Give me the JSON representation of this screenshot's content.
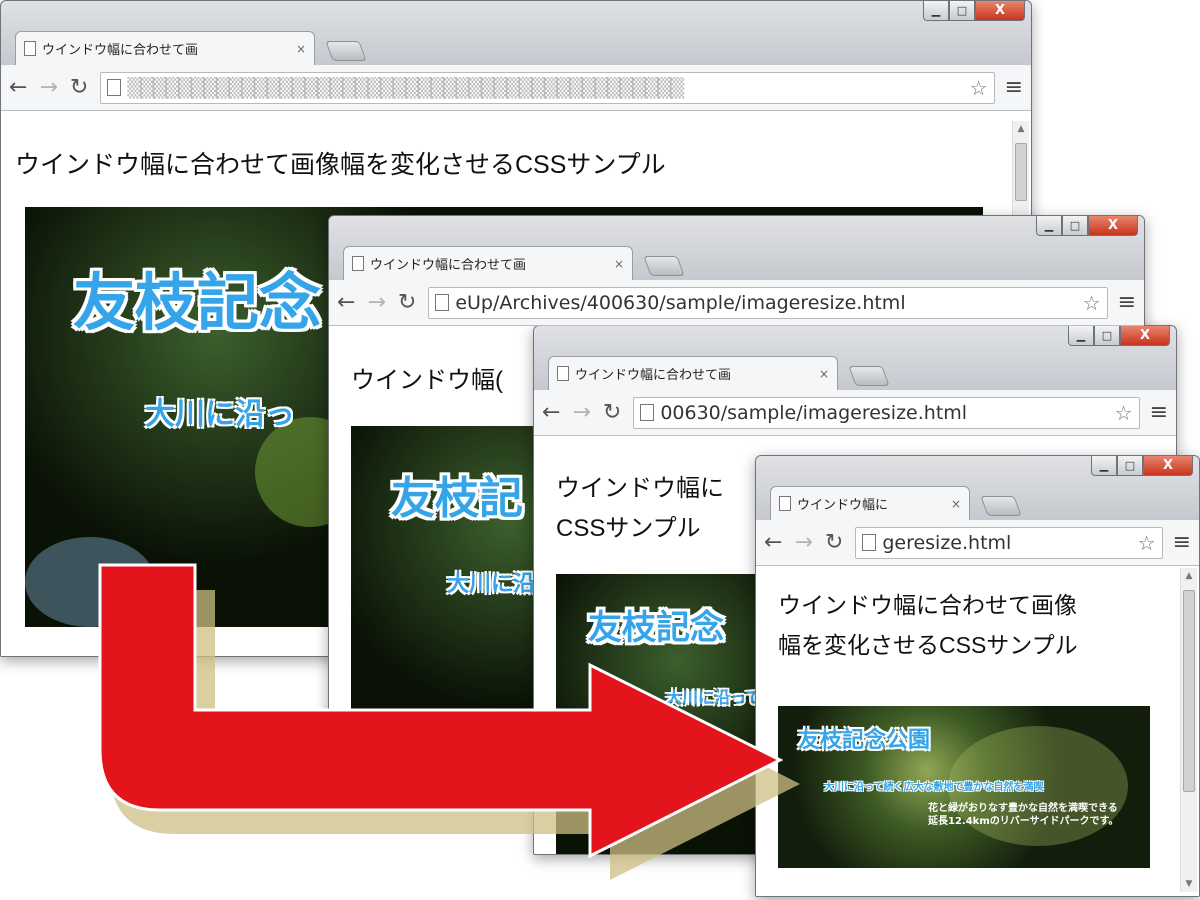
{
  "windows": [
    {
      "tab_title": "ウインドウ幅に合わせて画",
      "url": "▒▒▒▒▒▒▒▒▒▒▒▒▒▒▒▒▒▒▒▒▒▒▒▒▒▒▒▒▒▒▒▒▒▒▒▒▒▒▒▒▒▒▒▒",
      "page_title": "ウインドウ幅に合わせて画像幅を変化させるCSSサンプル",
      "hero_title": "友枝記念",
      "hero_subtitle": "大川に沿っ"
    },
    {
      "tab_title": "ウインドウ幅に合わせて画",
      "url": "eUp/Archives/400630/sample/imageresize.html",
      "page_title": "ウインドウ幅(",
      "hero_title": "友枝記",
      "hero_subtitle": "大川に沿"
    },
    {
      "tab_title": "ウインドウ幅に合わせて画",
      "url": "00630/sample/imageresize.html",
      "page_title_line1": "ウインドウ幅に",
      "page_title_line2": "CSSサンプル",
      "hero_title": "友枝記念",
      "hero_subtitle": "大川に沿って"
    },
    {
      "tab_title": "ウインドウ幅に",
      "url": "geresize.html",
      "page_title_line1": "ウインドウ幅に合わせて画像",
      "page_title_line2": "幅を変化させるCSSサンプル",
      "hero_title": "友枝記念公園",
      "hero_subtitle": "大川に沿って続く広大な敷地で豊かな自然を満喫",
      "hero_desc_line1": "花と緑がおりなす豊かな自然を満喫できる",
      "hero_desc_line2": "延長12.4kmのリバーサイドパークです。"
    }
  ],
  "window_controls": {
    "minimize": "▁",
    "maximize": "□",
    "close": "X"
  },
  "nav": {
    "back": "←",
    "forward": "→",
    "reload": "↻",
    "star": "☆",
    "menu": "≡",
    "tab_close": "×"
  },
  "colors": {
    "arrow": "#e3141c",
    "hero_title": "#35a4e8",
    "close_button": "#d44a2e"
  }
}
